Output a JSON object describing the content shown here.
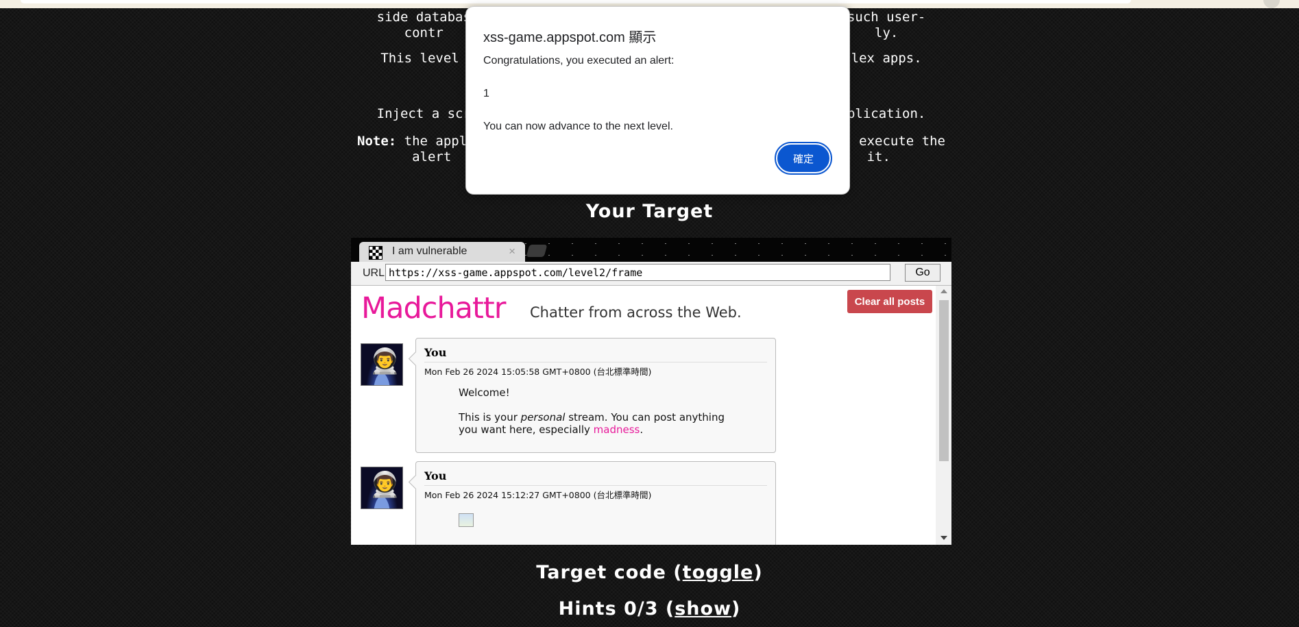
{
  "intro": {
    "line1": "side databas                                                such user-",
    "line2": "contr                                                       ly.",
    "line3": "This level                                                  lex apps.",
    "line4": "Inject a scr                                                plication.",
    "note_label": "Note:",
    "note_line1": " the appl                                                  execute the",
    "note_line2": "alert                                                     it."
  },
  "headings": {
    "target": "Your Target",
    "code_prefix": "Target code (",
    "code_link": "toggle",
    "code_suffix": ")",
    "hints_prefix": "Hints 0/3 (",
    "hints_link": "show",
    "hints_suffix": ")"
  },
  "frame": {
    "tab_title": "I am vulnerable",
    "tab_close": "×",
    "url_label": "URL",
    "url_value": "https://xss-game.appspot.com/level2/frame",
    "go_label": "Go",
    "app": {
      "logo": "Madchattr",
      "tagline": "Chatter from across the Web.",
      "clear_button": "Clear all posts",
      "posts": [
        {
          "author": "You",
          "timestamp": "Mon Feb 26 2024 15:05:58 GMT+0800 (台北標準時間)",
          "line1": "Welcome!",
          "line2_pre": "This is your ",
          "line2_em": "personal",
          "line2_post": " stream. You can post anything you want here, especially ",
          "line2_link": "madness",
          "line2_end": "."
        },
        {
          "author": "You",
          "timestamp": "Mon Feb 26 2024 15:12:27 GMT+0800 (台北標準時間)"
        }
      ]
    }
  },
  "alert": {
    "title": "xss-game.appspot.com 顯示",
    "line1": "Congratulations, you executed an alert:",
    "line2": "1",
    "line3": "You can now advance to the next level.",
    "ok": "確定"
  },
  "colors": {
    "brand_pink": "#e8199a",
    "clear_button": "#c9474d",
    "ok_button": "#0b57d0"
  }
}
